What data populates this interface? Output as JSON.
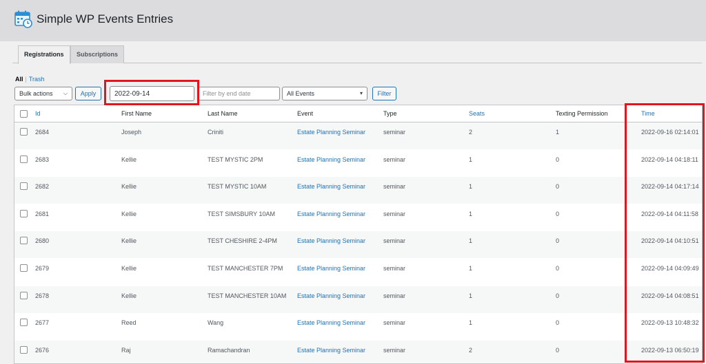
{
  "app": {
    "title": "Simple WP Events Entries",
    "logo_icon": "calendar-clock-icon"
  },
  "tabs": [
    {
      "label": "Registrations",
      "active": true
    },
    {
      "label": "Subscriptions",
      "active": false
    }
  ],
  "views": {
    "all": "All",
    "separator": "|",
    "trash": "Trash"
  },
  "toolbar": {
    "bulk_actions": "Bulk actions",
    "apply": "Apply",
    "start_date_value": "2022-09-14",
    "end_date_placeholder": "Filter by end date",
    "events_select": "All Events",
    "filter": "Filter"
  },
  "colors": {
    "highlight": "#e3141b",
    "link": "#2271b1",
    "header_bg": "#dcdcde"
  },
  "table": {
    "headers": {
      "id": "Id",
      "first_name": "First Name",
      "last_name": "Last Name",
      "event": "Event",
      "type": "Type",
      "seats": "Seats",
      "texting": "Texting Permission",
      "time": "Time"
    },
    "rows": [
      {
        "id": "2684",
        "first": "Joseph",
        "last": "Criniti",
        "event": "Estate Planning Seminar",
        "type": "seminar",
        "seats": "2",
        "texting": "1",
        "time": "2022-09-16 02:14:01"
      },
      {
        "id": "2683",
        "first": "Kellie",
        "last": "TEST MYSTIC 2PM",
        "event": "Estate Planning Seminar",
        "type": "seminar",
        "seats": "1",
        "texting": "0",
        "time": "2022-09-14 04:18:11"
      },
      {
        "id": "2682",
        "first": "Kellie",
        "last": "TEST MYSTIC 10AM",
        "event": "Estate Planning Seminar",
        "type": "seminar",
        "seats": "1",
        "texting": "0",
        "time": "2022-09-14 04:17:14"
      },
      {
        "id": "2681",
        "first": "Kellie",
        "last": "TEST SIMSBURY 10AM",
        "event": "Estate Planning Seminar",
        "type": "seminar",
        "seats": "1",
        "texting": "0",
        "time": "2022-09-14 04:11:58"
      },
      {
        "id": "2680",
        "first": "Kellie",
        "last": "TEST CHESHIRE 2-4PM",
        "event": "Estate Planning Seminar",
        "type": "seminar",
        "seats": "1",
        "texting": "0",
        "time": "2022-09-14 04:10:51"
      },
      {
        "id": "2679",
        "first": "Kellie",
        "last": "TEST MANCHESTER 7PM",
        "event": "Estate Planning Seminar",
        "type": "seminar",
        "seats": "1",
        "texting": "0",
        "time": "2022-09-14 04:09:49"
      },
      {
        "id": "2678",
        "first": "Kellie",
        "last": "TEST MANCHESTER 10AM",
        "event": "Estate Planning Seminar",
        "type": "seminar",
        "seats": "1",
        "texting": "0",
        "time": "2022-09-14 04:08:51"
      },
      {
        "id": "2677",
        "first": "Reed",
        "last": "Wang",
        "event": "Estate Planning Seminar",
        "type": "seminar",
        "seats": "1",
        "texting": "0",
        "time": "2022-09-13 10:48:32"
      },
      {
        "id": "2676",
        "first": "Raj",
        "last": "Ramachandran",
        "event": "Estate Planning Seminar",
        "type": "seminar",
        "seats": "2",
        "texting": "0",
        "time": "2022-09-13 06:50:19"
      }
    ]
  }
}
